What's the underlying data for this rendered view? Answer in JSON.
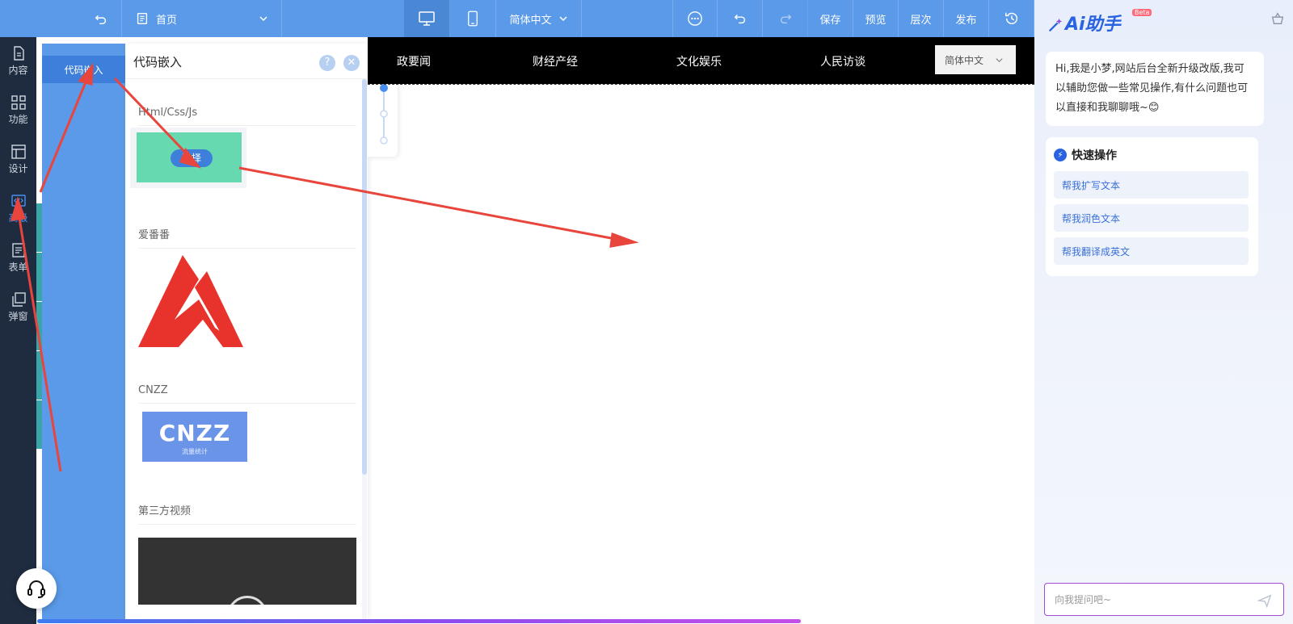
{
  "toolbar": {
    "page_label": "首页",
    "lang_label": "简体中文",
    "save_label": "保存",
    "preview_label": "预览",
    "layers_label": "层次",
    "publish_label": "发布"
  },
  "sidebar": {
    "items": [
      {
        "label": "内容",
        "icon": "content-icon"
      },
      {
        "label": "功能",
        "icon": "apps-icon"
      },
      {
        "label": "设计",
        "icon": "layout-icon"
      },
      {
        "label": "高级",
        "icon": "code-icon"
      },
      {
        "label": "表单",
        "icon": "form-icon"
      },
      {
        "label": "弹窗",
        "icon": "popup-icon"
      }
    ]
  },
  "category": {
    "active_tab": "代码嵌入"
  },
  "panel": {
    "title": "代码嵌入",
    "help": "?",
    "close": "✕",
    "sections": [
      {
        "title": "Html/Css/Js",
        "button": "选择"
      },
      {
        "title": "爱番番"
      },
      {
        "title": "CNZZ",
        "logo_text": "CNZZ",
        "logo_sub": "流量统计"
      },
      {
        "title": "第三方视频"
      }
    ]
  },
  "canvas": {
    "nav_items": [
      "政要闻",
      "财经产经",
      "文化娱乐",
      "人民访谈"
    ],
    "lang_label": "简体中文"
  },
  "ai": {
    "title": "Ai助手",
    "beta": "Beta",
    "greeting": "Hi,我是小梦,网站后台全新升级改版,我可以辅助您做一些常见操作,有什么问题也可以直接和我聊聊哦~😊",
    "quick_title": "快速操作",
    "quick_actions": [
      "帮我扩写文本",
      "帮我润色文本",
      "帮我翻译成英文"
    ],
    "input_placeholder": "向我提问吧~"
  },
  "colors": {
    "toolbar_bg": "#5b9ae8",
    "sidebar_bg": "#1f2c3f",
    "accent": "#2a63e0",
    "arrow": "#e8453c"
  }
}
